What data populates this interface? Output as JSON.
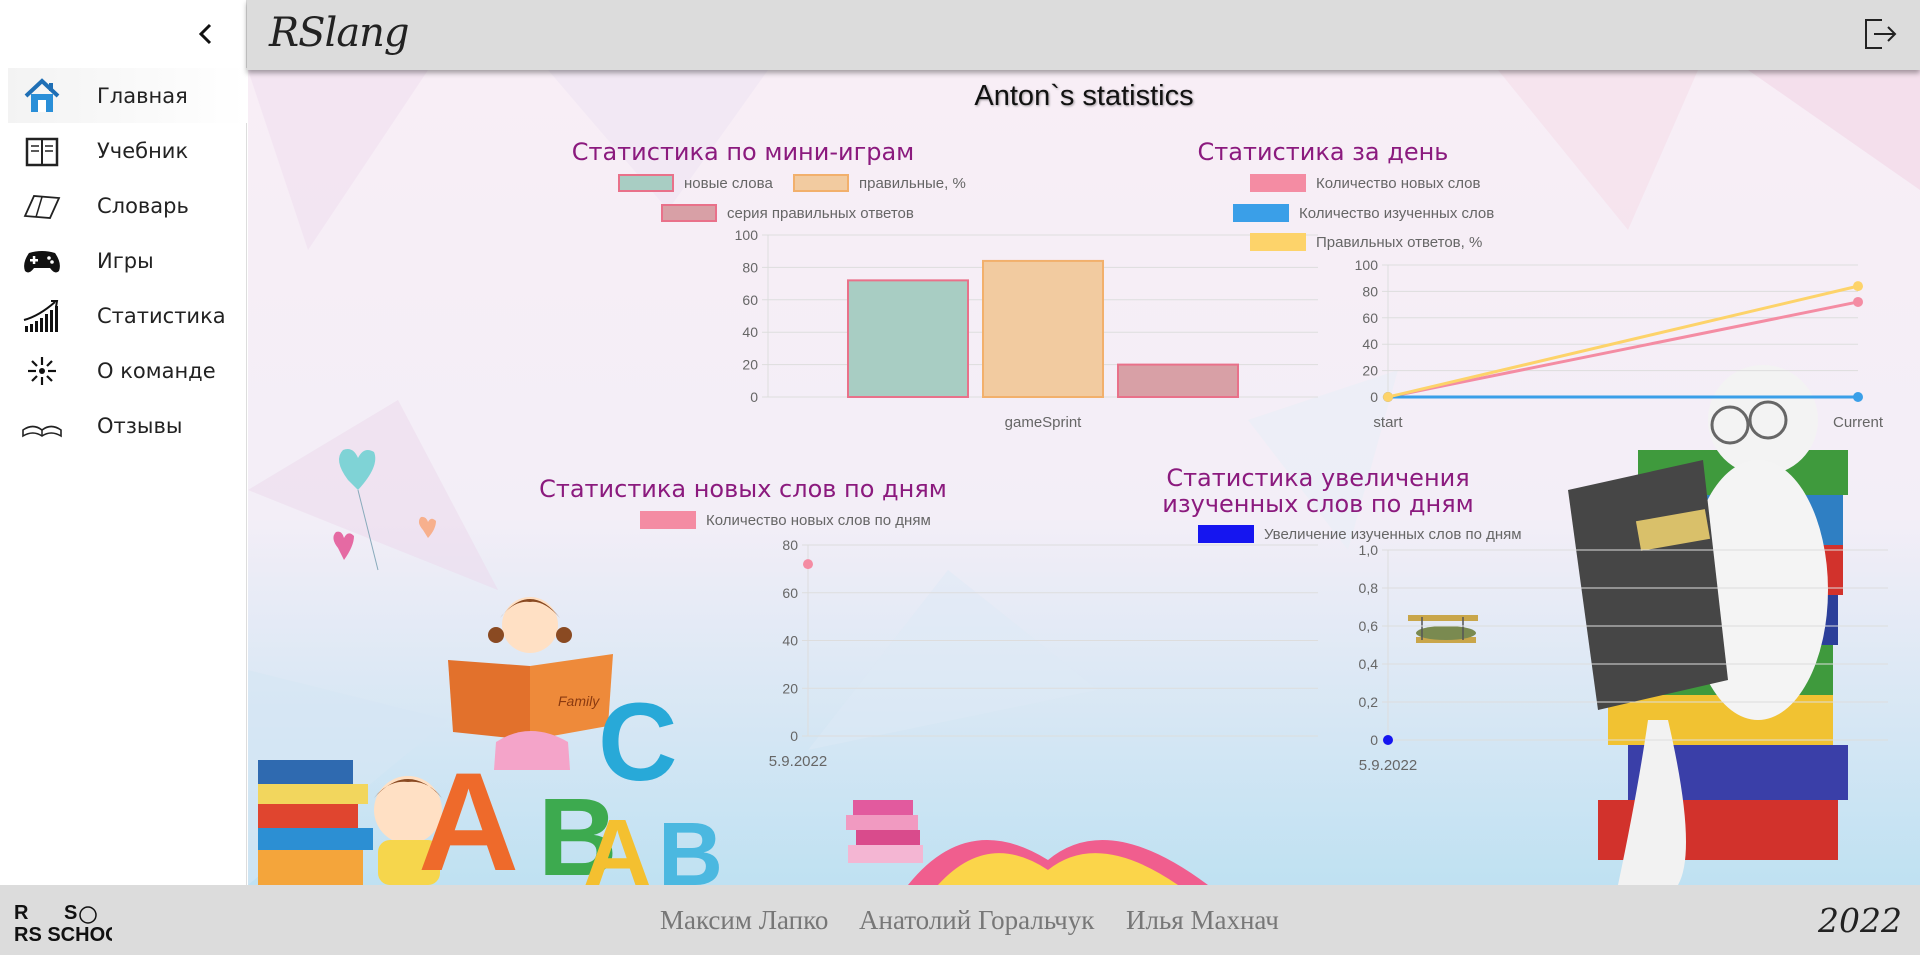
{
  "header": {
    "logo": "RSlang",
    "collapse_icon": "chevron-left-icon",
    "logout_icon": "logout-icon"
  },
  "sidebar": {
    "items": [
      {
        "label": "Главная",
        "icon": "home-icon",
        "active": true
      },
      {
        "label": "Учебник",
        "icon": "textbook-icon"
      },
      {
        "label": "Словарь",
        "icon": "dictionary-icon"
      },
      {
        "label": "Игры",
        "icon": "gamepad-icon"
      },
      {
        "label": "Статистика",
        "icon": "statistics-icon"
      },
      {
        "label": "О команде",
        "icon": "team-icon"
      },
      {
        "label": "Отзывы",
        "icon": "reviews-icon"
      }
    ]
  },
  "main": {
    "title": "Anton`s statistics"
  },
  "chart_data": [
    {
      "type": "bar",
      "title": "Статистика по мини-играм",
      "categories": [
        "gameSprint"
      ],
      "series": [
        {
          "name": "новые слова",
          "values": [
            72
          ],
          "fill": "#a8cdc3",
          "stroke": "#e9718a"
        },
        {
          "name": "правильные, %",
          "values": [
            84
          ],
          "fill": "#f2cba0",
          "stroke": "#f2b06c"
        },
        {
          "name": "серия правильных ответов",
          "values": [
            20
          ],
          "fill": "#d8a0a6",
          "stroke": "#e9718a"
        }
      ],
      "ylim": [
        0,
        100
      ],
      "yticks": [
        "100",
        "80",
        "60",
        "40",
        "20",
        "0"
      ]
    },
    {
      "type": "line",
      "title": "Статистика за день",
      "x": [
        "start",
        "Current"
      ],
      "series": [
        {
          "name": "Количество новых слов",
          "values": [
            0,
            72
          ],
          "color": "#f48ca3"
        },
        {
          "name": "Количество изученных слов",
          "values": [
            0,
            0
          ],
          "color": "#3a9fe8"
        },
        {
          "name": "Правильных ответов, %",
          "values": [
            0,
            84
          ],
          "color": "#fdd36a"
        }
      ],
      "ylim": [
        0,
        100
      ],
      "yticks": [
        "100",
        "80",
        "60",
        "40",
        "20",
        "0"
      ]
    },
    {
      "type": "line",
      "title": "Статистика новых слов по дням",
      "x": [
        "5.9.2022"
      ],
      "series": [
        {
          "name": "Количество новых слов по дням",
          "values": [
            72
          ],
          "color": "#f48ca3"
        }
      ],
      "ylim": [
        0,
        80
      ],
      "yticks": [
        "80",
        "60",
        "40",
        "20",
        "0"
      ]
    },
    {
      "type": "line",
      "title": "Статистика увеличения изученных слов по дням",
      "x": [
        "5.9.2022"
      ],
      "series": [
        {
          "name": "Увеличение изученных слов по дням",
          "values": [
            0
          ],
          "color": "#1515f0"
        }
      ],
      "ylim": [
        0,
        1
      ],
      "yticks": [
        "1,0",
        "0,8",
        "0,6",
        "0,4",
        "0,2",
        "0"
      ]
    }
  ],
  "footer": {
    "logo_text": "RS SCHOOL",
    "authors": [
      "Максим Лапко",
      "Анатолий Горальчук",
      "Илья Махнач"
    ],
    "year": "2022"
  }
}
